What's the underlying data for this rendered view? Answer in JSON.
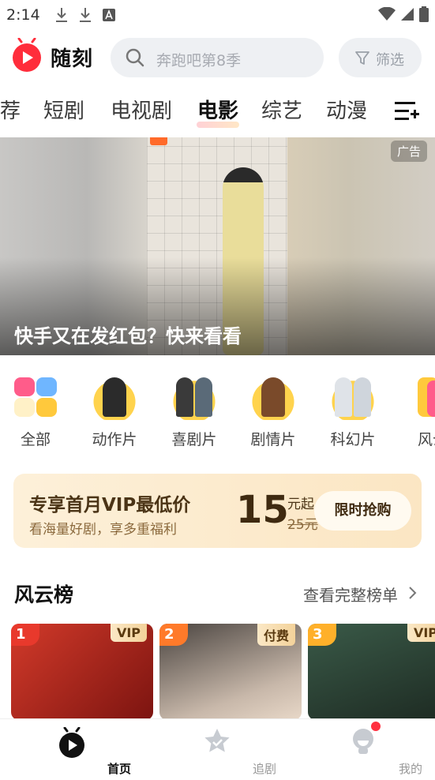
{
  "status_bar": {
    "time": "2:14"
  },
  "header": {
    "app_name": "随刻",
    "search_placeholder": "奔跑吧第8季",
    "filter_label": "筛选"
  },
  "tabs": [
    {
      "label": "荐"
    },
    {
      "label": "短剧"
    },
    {
      "label": "电视剧"
    },
    {
      "label": "电影",
      "active": true
    },
    {
      "label": "综艺"
    },
    {
      "label": "动漫"
    }
  ],
  "banner": {
    "caption": "快手又在发红包？快来看看",
    "ad_label": "广告"
  },
  "genres": [
    {
      "label": "全部"
    },
    {
      "label": "动作片"
    },
    {
      "label": "喜剧片"
    },
    {
      "label": "剧情片"
    },
    {
      "label": "科幻片"
    },
    {
      "label": "风云"
    }
  ],
  "vip_card": {
    "title": "专享首月VIP最低价",
    "subtitle": "看海量好剧，享多重福利",
    "price": "15",
    "unit": "元起",
    "original_price": "25元",
    "button": "限时抢购"
  },
  "ranking": {
    "title": "风云榜",
    "more": "查看完整榜单",
    "cards": [
      {
        "rank": "1",
        "tag": "VIP"
      },
      {
        "rank": "2",
        "tag": "付费"
      },
      {
        "rank": "3",
        "tag": "VIP"
      }
    ]
  },
  "bottom_nav": [
    {
      "label": "首页",
      "active": true
    },
    {
      "label": "追剧"
    },
    {
      "label": "我的"
    }
  ],
  "colors": {
    "brand_red": "#ff2d3b",
    "vip_gold": "#fbe6c3",
    "inactive_gray": "#999999"
  }
}
